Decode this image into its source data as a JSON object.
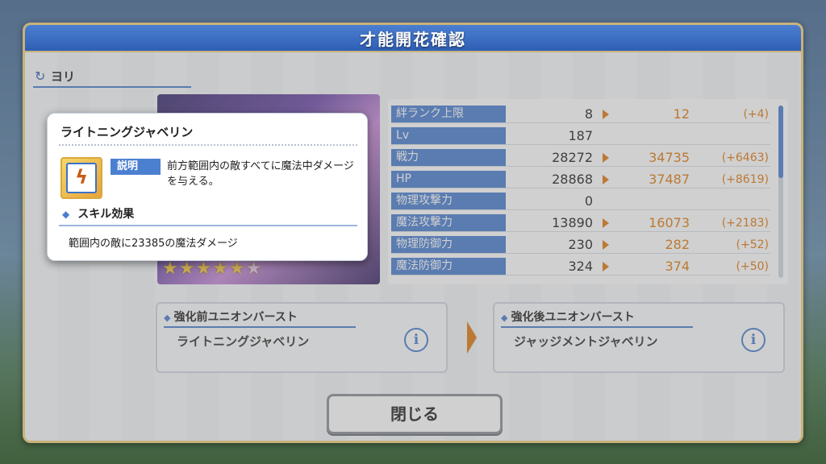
{
  "dialog": {
    "title": "才能開花確認",
    "close_label": "閉じる"
  },
  "character": {
    "name": "ヨリ",
    "stars_filled": 5,
    "stars_total": 6
  },
  "stats": [
    {
      "label": "絆ランク上限",
      "base": "8",
      "new": "12",
      "diff": "(+4)"
    },
    {
      "label": "Lv",
      "base": "187",
      "new": "",
      "diff": ""
    },
    {
      "label": "戦力",
      "base": "28272",
      "new": "34735",
      "diff": "(+6463)"
    },
    {
      "label": "HP",
      "base": "28868",
      "new": "37487",
      "diff": "(+8619)"
    },
    {
      "label": "物理攻撃力",
      "base": "0",
      "new": "",
      "diff": ""
    },
    {
      "label": "魔法攻撃力",
      "base": "13890",
      "new": "16073",
      "diff": "(+2183)"
    },
    {
      "label": "物理防御力",
      "base": "230",
      "new": "282",
      "diff": "(+52)"
    },
    {
      "label": "魔法防御力",
      "base": "324",
      "new": "374",
      "diff": "(+50)"
    }
  ],
  "union_burst": {
    "before": {
      "header": "強化前ユニオンバースト",
      "name": "ライトニングジャベリン"
    },
    "after": {
      "header": "強化後ユニオンバースト",
      "name": "ジャッジメントジャベリン"
    },
    "info_label": "i"
  },
  "popup": {
    "title": "ライトニングジャベリン",
    "desc_tag": "説明",
    "desc_text": "前方範囲内の敵すべてに魔法中ダメージを与える。",
    "effect_header": "スキル効果",
    "effect_text": "範囲内の敵に23385の魔法ダメージ"
  }
}
